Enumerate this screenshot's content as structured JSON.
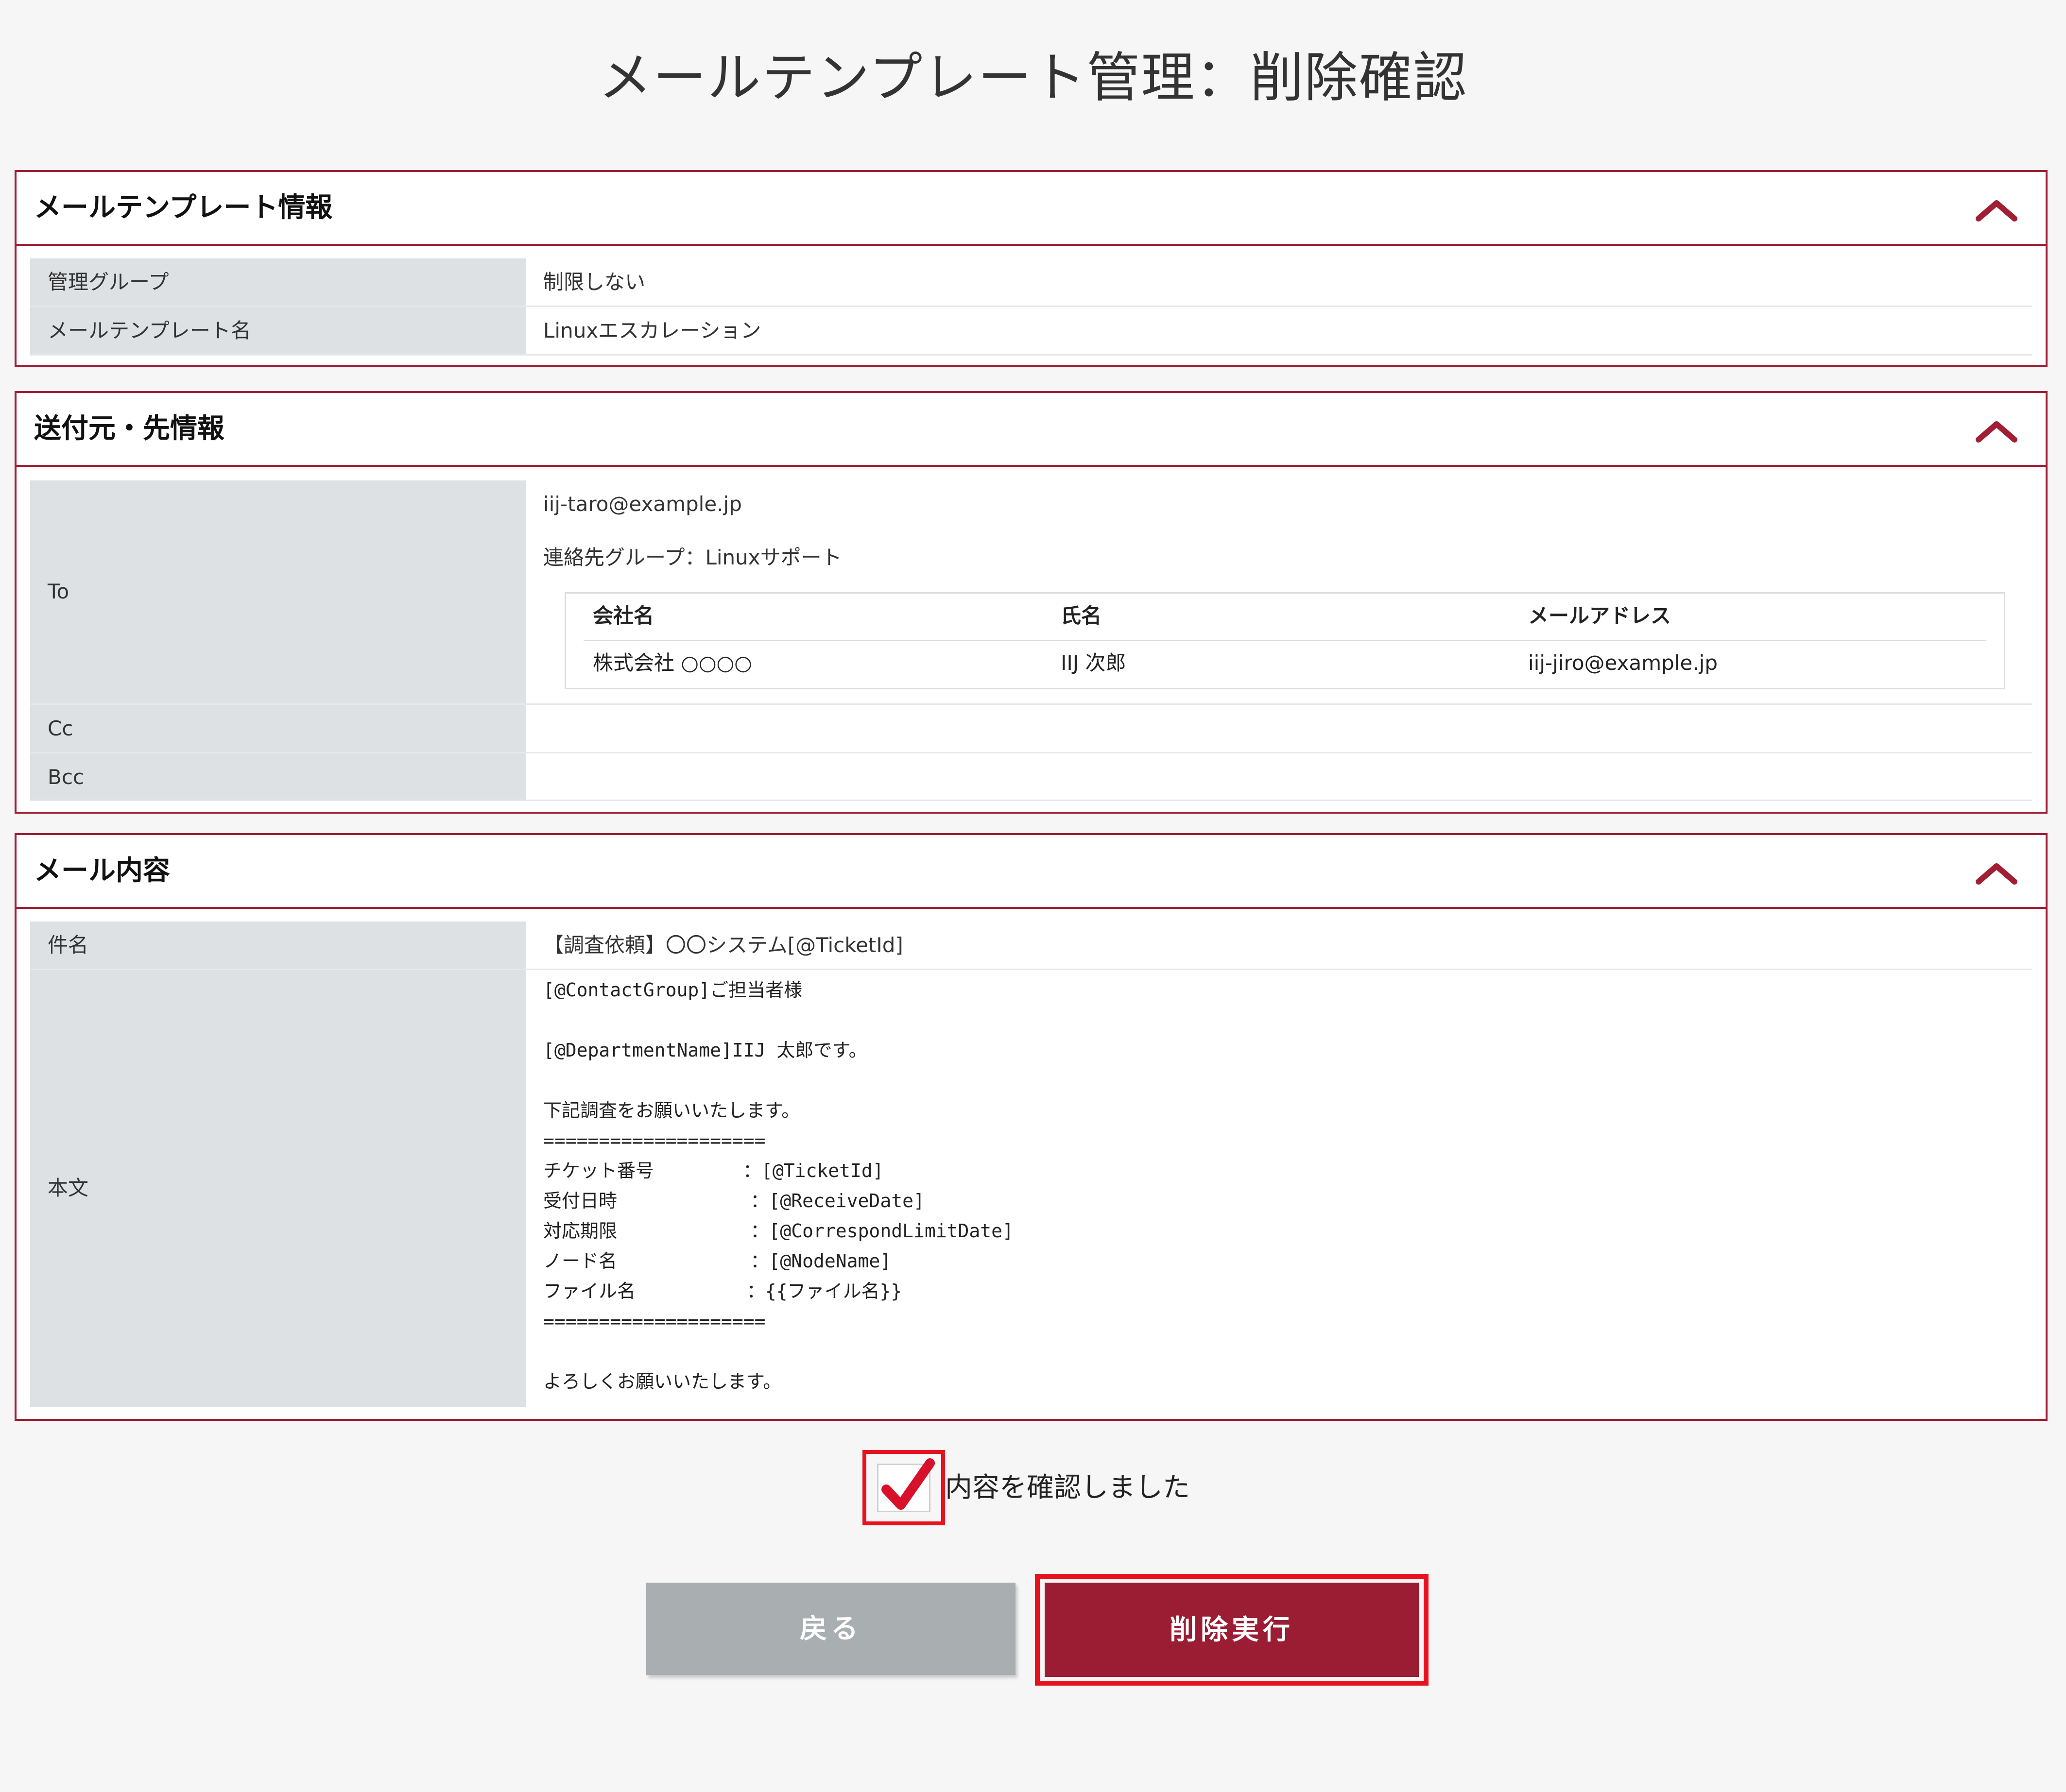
{
  "page": {
    "title": "メールテンプレート管理：削除確認"
  },
  "template_info": {
    "title": "メールテンプレート情報",
    "rows": [
      {
        "label": "管理グループ",
        "value": "制限しない"
      },
      {
        "label": "メールテンプレート名",
        "value": "Linuxエスカレーション"
      }
    ]
  },
  "sender_info": {
    "title": "送付元・先情報",
    "to": {
      "label": "To",
      "address": "iij-taro@example.jp",
      "group_line": "連絡先グループ：Linuxサポート",
      "table": {
        "headers": [
          "会社名",
          "氏名",
          "メールアドレス"
        ],
        "rows": [
          [
            "株式会社 ○○○○",
            "IIJ 次郎",
            "iij-jiro@example.jp"
          ]
        ]
      }
    },
    "cc": {
      "label": "Cc",
      "value": ""
    },
    "bcc": {
      "label": "Bcc",
      "value": ""
    }
  },
  "mail_content": {
    "title": "メール内容",
    "subject": {
      "label": "件名",
      "value": "【調査依頼】〇〇システム[@TicketId]"
    },
    "body": {
      "label": "本文",
      "value": "[@ContactGroup]ご担当者様\n\n[@DepartmentName]IIJ 太郎です。\n\n下記調査をお願いいたします。\n====================\nチケット番号        ：[@TicketId]\n受付日時            ：[@ReceiveDate]\n対応期限            ：[@CorrespondLimitDate]\nノード名            ：[@NodeName]\nファイル名          ：{{ファイル名}}\n====================\n\nよろしくお願いいたします。"
    }
  },
  "confirm": {
    "label": "内容を確認しました",
    "checked": true
  },
  "buttons": {
    "back": "戻る",
    "delete": "削除実行"
  },
  "icons": {
    "collapse": "chevron-up-icon",
    "check": "checkmark-icon"
  },
  "colors": {
    "accent": "#a01f35",
    "highlight": "#e8121e",
    "delete_button": "#9a1d34",
    "back_button": "#a9aeb1"
  }
}
